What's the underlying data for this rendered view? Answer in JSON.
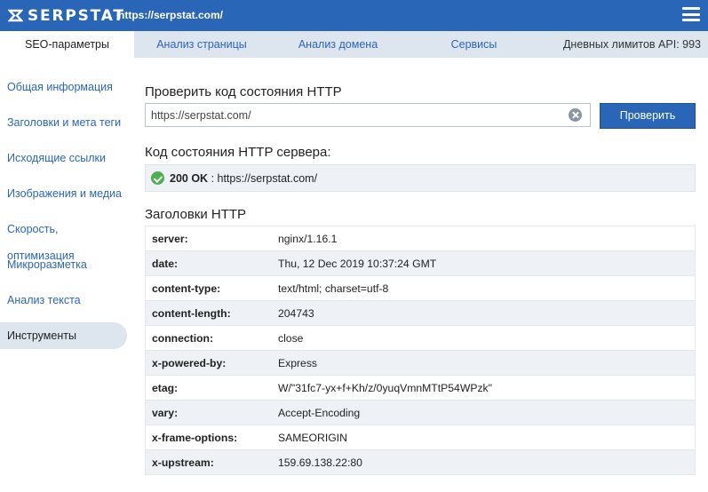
{
  "topbar": {
    "logo_text": "SERPSTAT",
    "url": "https://serpstat.com/",
    "menu_icon": "hamburger-menu-icon",
    "bg_color": "#2a66b8"
  },
  "tabs": [
    {
      "label": "SEO-параметры",
      "active": true
    },
    {
      "label": "Анализ страницы",
      "active": false
    },
    {
      "label": "Анализ домена",
      "active": false
    },
    {
      "label": "Сервисы",
      "active": false
    }
  ],
  "api_limits": "Дневных лимитов API: 993",
  "sidebar": {
    "items": [
      {
        "label": "Общая информация"
      },
      {
        "label": "Заголовки и мета теги"
      },
      {
        "label": "Исходящие ссылки"
      },
      {
        "label": "Изображения и медиа"
      },
      {
        "label": "Скорость, оптимизация"
      },
      {
        "label": "Микроразметка"
      },
      {
        "label": "Анализ текста"
      },
      {
        "label": "Инструменты",
        "active": true
      }
    ]
  },
  "check": {
    "title": "Проверить код состояния HTTP",
    "input_value": "https://serpstat.com/",
    "button_label": "Проверить",
    "clear_icon": "clear-x-icon"
  },
  "status": {
    "title": "Код состояния HTTP сервера:",
    "code": "200 OK",
    "detail": " : https://serpstat.com/",
    "icon": "check-circle-icon",
    "icon_color": "#4caf50"
  },
  "headers": {
    "title": "Заголовки HTTP",
    "rows": [
      {
        "name": "server:",
        "value": "nginx/1.16.1"
      },
      {
        "name": "date:",
        "value": "Thu, 12 Dec 2019 10:37:24 GMT"
      },
      {
        "name": "content-type:",
        "value": "text/html; charset=utf-8"
      },
      {
        "name": "content-length:",
        "value": "204743"
      },
      {
        "name": "connection:",
        "value": "close"
      },
      {
        "name": "x-powered-by:",
        "value": "Express"
      },
      {
        "name": "etag:",
        "value": "W/\"31fc7-yx+f+Kh/z/0yuqVmnMTtP54WPzk\""
      },
      {
        "name": "vary:",
        "value": "Accept-Encoding"
      },
      {
        "name": "x-frame-options:",
        "value": "SAMEORIGIN"
      },
      {
        "name": "x-upstream:",
        "value": "159.69.138.22:80"
      }
    ]
  }
}
